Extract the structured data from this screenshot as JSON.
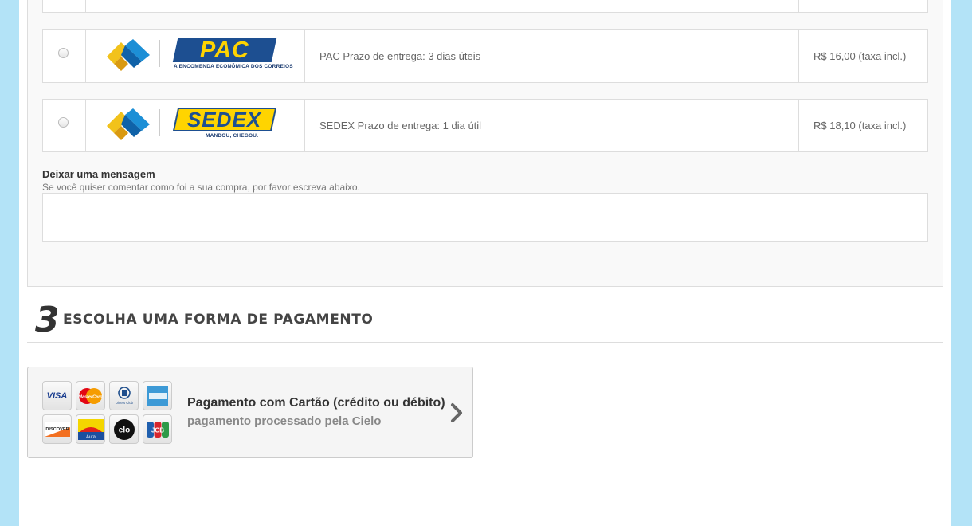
{
  "shipping": {
    "options": [
      {
        "brand": "PAC",
        "brand_tagline": "A ENCOMENDA ECONÔMICA DOS CORREIOS",
        "description": "PAC Prazo de entrega: 3 dias úteis",
        "price": "R$ 16,00 (taxa incl.)"
      },
      {
        "brand": "SEDEX",
        "brand_tagline": "MANDOU, CHEGOU.",
        "description": "SEDEX Prazo de entrega: 1 dia útil",
        "price": "R$ 18,10 (taxa incl.)"
      }
    ]
  },
  "message": {
    "title": "Deixar uma mensagem",
    "subtitle": "Se você quiser comentar como foi a sua compra, por favor escreva abaixo.",
    "value": ""
  },
  "payment_step": {
    "number": "3",
    "title": "ESCOLHA UMA FORMA DE PAGAMENTO"
  },
  "payment_option": {
    "title": "Pagamento com Cartão (crédito ou débito)",
    "subtitle": "pagamento processado pela Cielo",
    "card_brands": [
      {
        "icon": "visa-icon",
        "label": "VISA"
      },
      {
        "icon": "mastercard-icon",
        "label": "MasterCard"
      },
      {
        "icon": "diners-club-icon",
        "label": "Diners Club"
      },
      {
        "icon": "american-express-icon",
        "label": ""
      },
      {
        "icon": "discover-icon",
        "label": "DISCOVER"
      },
      {
        "icon": "aura-icon",
        "label": "Aura"
      },
      {
        "icon": "elo-icon",
        "label": "elo"
      },
      {
        "icon": "jcb-icon",
        "label": "JCB"
      }
    ]
  },
  "colors": {
    "page_background": "#b3e3f7",
    "correios_blue": "#1d4f91",
    "correios_yellow": "#ffd400"
  }
}
